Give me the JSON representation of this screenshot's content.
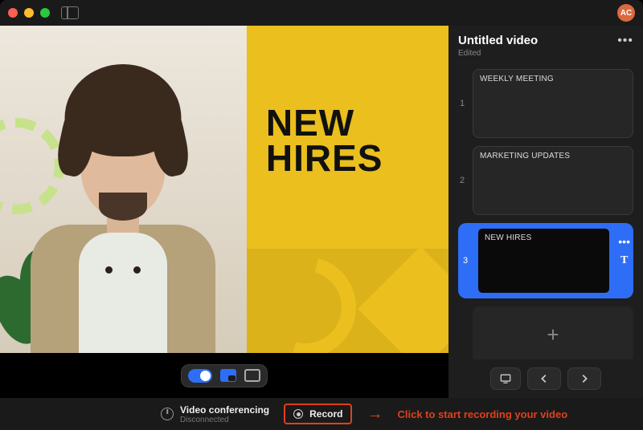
{
  "window": {
    "avatar_initials": "AC"
  },
  "colors": {
    "close": "#ff5f57",
    "min": "#febc2e",
    "max": "#28c840",
    "accent": "#2e6df6",
    "callout": "#e0401c",
    "slide_bg": "#eabf1e"
  },
  "preview": {
    "slide_title": "NEW\nHIRES"
  },
  "controls": {
    "camera_toggle_on": true
  },
  "project": {
    "title": "Untitled video",
    "subtitle": "Edited"
  },
  "slides": [
    {
      "num": "1",
      "label": "WEEKLY MEETING",
      "selected": false
    },
    {
      "num": "2",
      "label": "MARKETING UPDATES",
      "selected": false
    },
    {
      "num": "3",
      "label": "NEW HIRES",
      "selected": true
    }
  ],
  "add_label": "+",
  "footer": {
    "vc_title": "Video conferencing",
    "vc_status": "Disconnected",
    "record_label": "Record",
    "hint": "Click to start recording your video"
  }
}
